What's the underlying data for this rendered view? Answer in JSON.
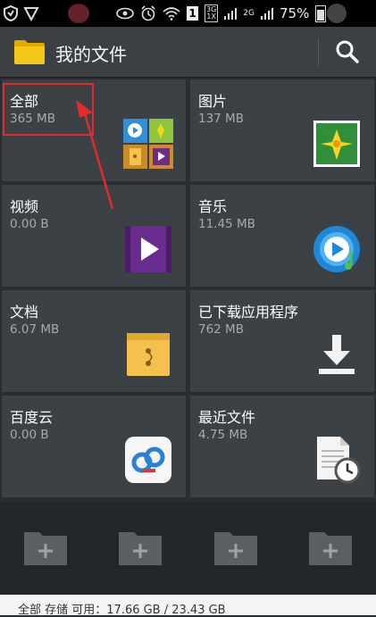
{
  "status_bar": {
    "network_top": "3G",
    "network_bottom": "1X",
    "network_alt": "2G",
    "sim_number": "1",
    "battery": "75%"
  },
  "app_bar": {
    "title": "我的文件",
    "icon": "folder-icon",
    "search_icon": "search-icon",
    "folder_color": "#f5c518"
  },
  "categories": [
    {
      "label": "全部",
      "size": "365 MB",
      "icon": "all-files-icon"
    },
    {
      "label": "图片",
      "size": "137 MB",
      "icon": "image-icon"
    },
    {
      "label": "视频",
      "size": "0.00 B",
      "icon": "video-icon"
    },
    {
      "label": "音乐",
      "size": "11.45 MB",
      "icon": "music-icon"
    },
    {
      "label": "文档",
      "size": "6.07 MB",
      "icon": "document-icon"
    },
    {
      "label": "已下载应用程序",
      "size": "762 MB",
      "icon": "download-icon"
    },
    {
      "label": "百度云",
      "size": "0.00 B",
      "icon": "baidu-cloud-icon"
    },
    {
      "label": "最近文件",
      "size": "4.75 MB",
      "icon": "recent-files-icon"
    }
  ],
  "quick_folders": [
    "add-folder-icon",
    "add-folder-icon",
    "add-folder-icon",
    "add-folder-icon"
  ],
  "footer": {
    "storage_text": "全部 存储 可用：17.66 GB / 23.43 GB"
  },
  "annotation_color": "#e02c2c"
}
